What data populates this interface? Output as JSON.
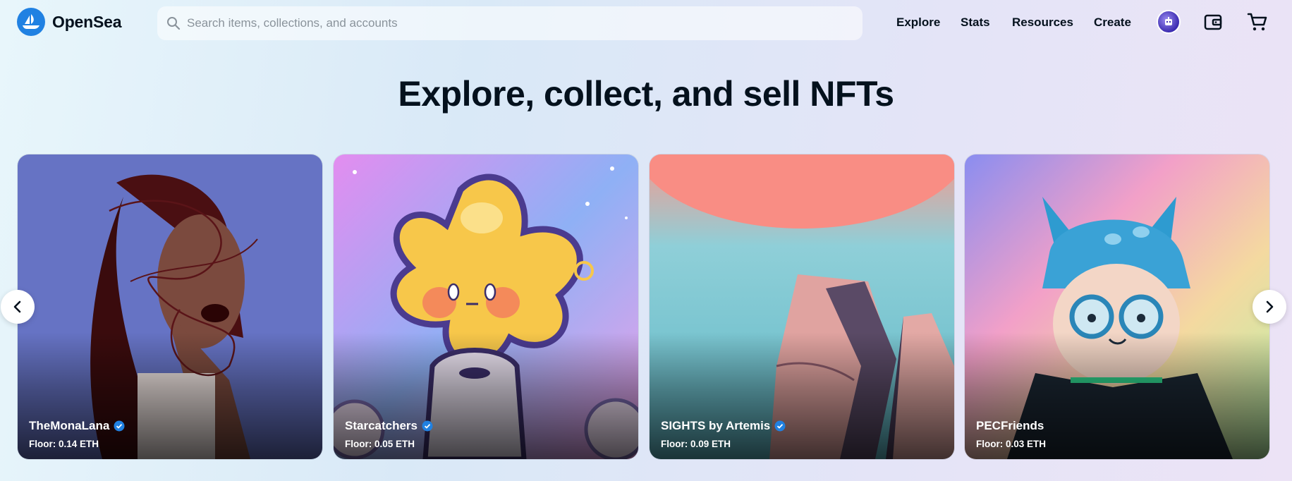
{
  "header": {
    "logo_text": "OpenSea",
    "search_placeholder": "Search items, collections, and accounts",
    "nav": [
      "Explore",
      "Stats",
      "Resources",
      "Create"
    ]
  },
  "hero": {
    "title": "Explore, collect, and sell NFTs"
  },
  "cards": [
    {
      "name": "TheMonaLana",
      "verified": true,
      "floor": "Floor: 0.14 ETH"
    },
    {
      "name": "Starcatchers",
      "verified": true,
      "floor": "Floor: 0.05 ETH"
    },
    {
      "name": "SIGHTS by Artemis",
      "verified": true,
      "floor": "Floor: 0.09 ETH"
    },
    {
      "name": "PECFriends",
      "verified": false,
      "floor": "Floor: 0.03 ETH"
    }
  ],
  "icons": {
    "logo": "opensea-boat-icon",
    "search": "search-icon",
    "avatar": "profile-avatar",
    "wallet": "wallet-icon",
    "cart": "cart-icon",
    "verified": "verified-badge-icon",
    "prev": "chevron-left-icon",
    "next": "chevron-right-icon"
  },
  "colors": {
    "brand": "#2081e2",
    "text": "#04111d"
  }
}
